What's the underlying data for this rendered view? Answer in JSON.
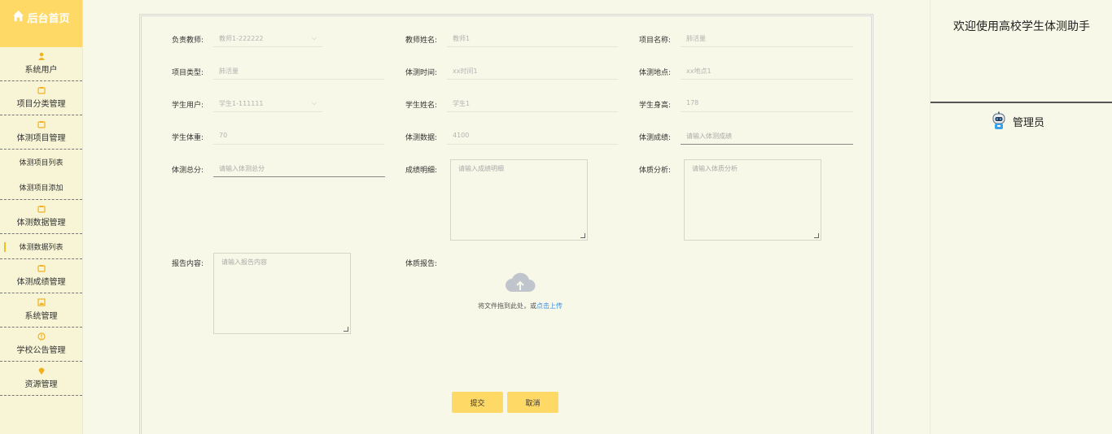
{
  "sidebar": {
    "home_label": "后台首页",
    "items": [
      {
        "label": "系统用户",
        "icon": "user-icon"
      },
      {
        "label": "项目分类管理",
        "icon": "folder-icon"
      },
      {
        "label": "体测项目管理",
        "icon": "folder-icon"
      },
      {
        "label": "体测项目列表",
        "icon": ""
      },
      {
        "label": "体测项目添加",
        "icon": ""
      },
      {
        "label": "体测数据管理",
        "icon": "folder-icon"
      },
      {
        "label": "体测数据列表",
        "icon": ""
      },
      {
        "label": "体测成绩管理",
        "icon": "folder-icon"
      },
      {
        "label": "系统管理",
        "icon": "image-icon"
      },
      {
        "label": "学校公告管理",
        "icon": "info-icon"
      },
      {
        "label": "资源管理",
        "icon": "location-icon"
      }
    ]
  },
  "form": {
    "teacher_select": {
      "label": "负责教师:",
      "value": "教师1-222222"
    },
    "teacher_name": {
      "label": "教师姓名:",
      "value": "教师1"
    },
    "project_name": {
      "label": "项目名称:",
      "value": "肺活量"
    },
    "project_type": {
      "label": "项目类型:",
      "value": "肺活量"
    },
    "test_time": {
      "label": "体测时间:",
      "value": "xx时间1"
    },
    "test_place": {
      "label": "体测地点:",
      "value": "xx地点1"
    },
    "student_user": {
      "label": "学生用户:",
      "value": "学生1-111111"
    },
    "student_name": {
      "label": "学生姓名:",
      "value": "学生1"
    },
    "student_height": {
      "label": "学生身高:",
      "value": "178"
    },
    "student_weight": {
      "label": "学生体重:",
      "value": "70"
    },
    "test_data": {
      "label": "体测数据:",
      "value": "4100"
    },
    "test_score": {
      "label": "体测成绩:",
      "placeholder": "请输入体测成绩"
    },
    "total_score": {
      "label": "体测总分:",
      "placeholder": "请输入体测总分"
    },
    "score_detail": {
      "label": "成绩明细:",
      "placeholder": "请输入成绩明细"
    },
    "physique_analysis": {
      "label": "体质分析:",
      "placeholder": "请输入体质分析"
    },
    "report_content": {
      "label": "报告内容:",
      "placeholder": "请输入报告内容"
    },
    "physique_report": {
      "label": "体质报告:"
    },
    "upload": {
      "text": "将文件拖到此处，或",
      "link": "点击上传"
    },
    "submit_label": "提交",
    "cancel_label": "取消"
  },
  "right": {
    "welcome": "欢迎使用高校学生体测助手",
    "user_role": "管理员"
  },
  "colors": {
    "accent": "#ffd966",
    "background": "#f8f8e8",
    "link": "#3a8ee6"
  }
}
